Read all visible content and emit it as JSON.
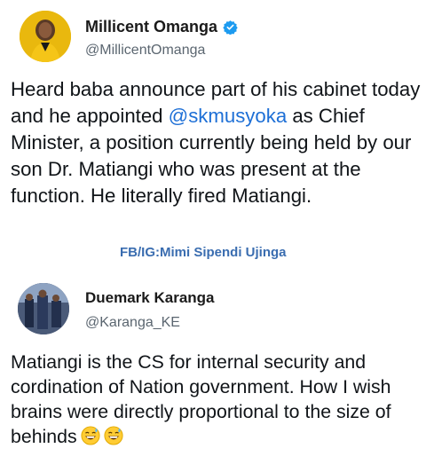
{
  "tweet1": {
    "author_name": "Millicent Omanga",
    "handle": "@MillicentOmanga",
    "verified": true,
    "text_before": "Heard baba announce part of his cabinet today and he appointed ",
    "mention": "@skmusyoka",
    "text_after": " as Chief Minister, a position currently being held by our son Dr. Matiangi who was present at the function. He literally fired Matiangi."
  },
  "watermark": "FB/IG:Mimi Sipendi Ujinga",
  "tweet2": {
    "author_name": "Duemark Karanga",
    "handle": "@Karanga_KE",
    "text": "Matiangi is the CS for internal security and cordination of Nation government. How I wish brains were directly proportional to the size of behinds",
    "emojis": [
      "grinning-sweat-emoji",
      "grinning-sweat-emoji"
    ]
  },
  "colors": {
    "mention": "#1d6fd6",
    "verified_badge": "#1d9bf0",
    "watermark": "#3a6db0"
  }
}
